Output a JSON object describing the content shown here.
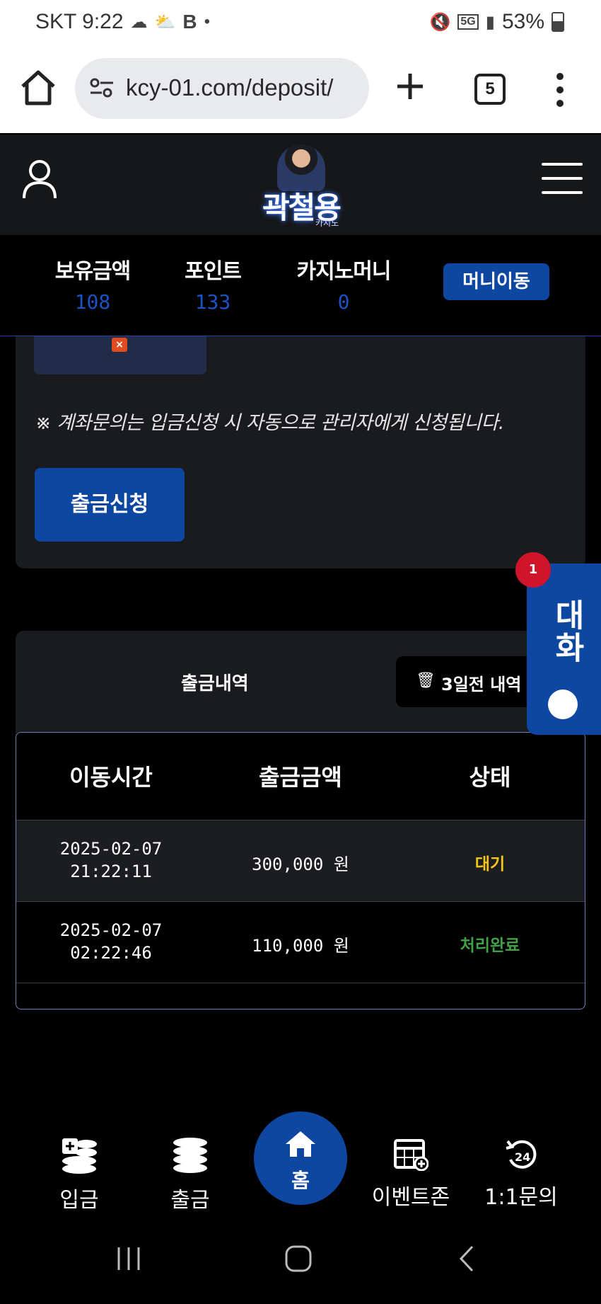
{
  "status_bar": {
    "carrier_time": "SKT 9:22",
    "network": "5G",
    "battery": "53%"
  },
  "browser": {
    "url": "kcy-01.com/deposit/",
    "tab_count": "5"
  },
  "header": {
    "logo_text": "곽철용",
    "logo_sub": "카지노"
  },
  "balances": {
    "holding_label": "보유금액",
    "holding_value": "108",
    "points_label": "포인트",
    "points_value": "133",
    "casino_label": "카지노머니",
    "casino_value": "0",
    "transfer_button": "머니이동"
  },
  "deposit_panel": {
    "notice": "※ 계좌문의는 입금신청 시 자동으로 관리자에게 신청됩니다.",
    "withdraw_button": "출금신청"
  },
  "history": {
    "title": "출금내역",
    "delete_button": "3일전 내역 삭제",
    "columns": [
      "이동시간",
      "출금금액",
      "상태"
    ],
    "rows": [
      {
        "date": "2025-02-07",
        "time": "21:22:11",
        "amount": "300,000 원",
        "status": "대기",
        "status_color": "#f5c518"
      },
      {
        "date": "2025-02-07",
        "time": "02:22:46",
        "amount": "110,000 원",
        "status": "처리완료",
        "status_color": "#43a047"
      }
    ]
  },
  "chat": {
    "label": "대화",
    "badge": "1"
  },
  "bottom_nav": {
    "deposit": "입금",
    "withdraw": "출금",
    "home": "홈",
    "events": "이벤트존",
    "support": "1:1문의"
  },
  "colors": {
    "accent": "#0d47a1",
    "balance_value": "#1b53c7",
    "panel": "#1a1b1e"
  }
}
